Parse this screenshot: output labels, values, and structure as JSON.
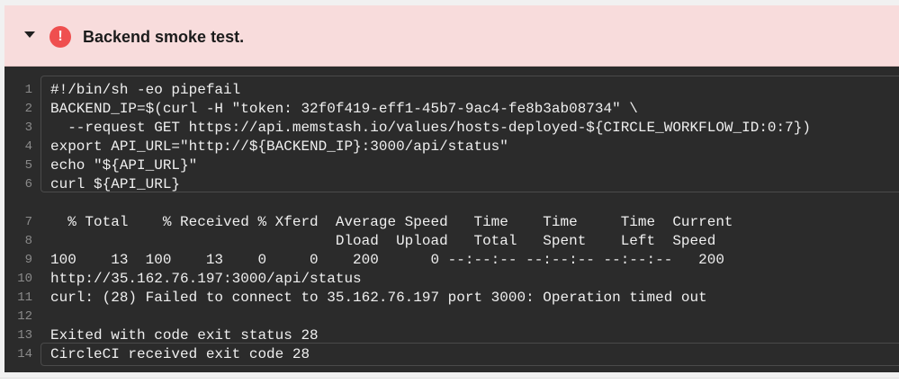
{
  "step": {
    "title": "Backend smoke test.",
    "status_icon": "!",
    "status": "failed",
    "status_color": "#ef4f4f"
  },
  "log": {
    "lines": [
      {
        "num": "1",
        "text": "#!/bin/sh -eo pipefail"
      },
      {
        "num": "2",
        "text": "BACKEND_IP=$(curl -H \"token: 32f0f419-eff1-45b7-9ac4-fe8b3ab08734\" \\"
      },
      {
        "num": "3",
        "text": "  --request GET https://api.memstash.io/values/hosts-deployed-${CIRCLE_WORKFLOW_ID:0:7})"
      },
      {
        "num": "4",
        "text": "export API_URL=\"http://${BACKEND_IP}:3000/api/status\""
      },
      {
        "num": "5",
        "text": "echo \"${API_URL}\""
      },
      {
        "num": "6",
        "text": "curl ${API_URL}"
      },
      {
        "num": "7",
        "text": "  % Total    % Received % Xferd  Average Speed   Time    Time     Time  Current"
      },
      {
        "num": "8",
        "text": "                                 Dload  Upload   Total   Spent    Left  Speed"
      },
      {
        "num": "9",
        "text": "100    13  100    13    0     0    200      0 --:--:-- --:--:-- --:--:--   200"
      },
      {
        "num": "10",
        "text": "http://35.162.76.197:3000/api/status"
      },
      {
        "num": "11",
        "text": "curl: (28) Failed to connect to 35.162.76.197 port 3000: Operation timed out"
      },
      {
        "num": "12",
        "text": ""
      },
      {
        "num": "13",
        "text": "Exited with code exit status 28"
      },
      {
        "num": "14",
        "text": "CircleCI received exit code 28"
      }
    ]
  }
}
